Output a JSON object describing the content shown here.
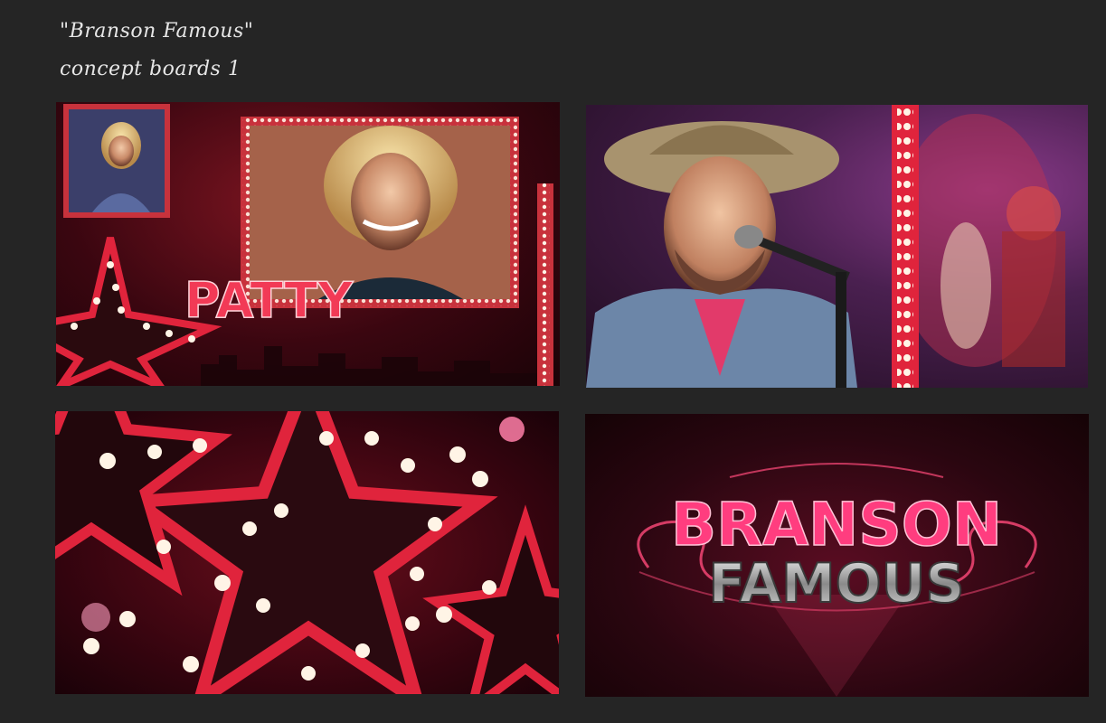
{
  "header": {
    "title": "\"Branson Famous\"",
    "subtitle": "concept boards 1"
  },
  "boards": {
    "board1": {
      "name_text": "PATTY"
    },
    "board4": {
      "logo_line1": "BRANSON",
      "logo_line2": "FAMOUS"
    }
  },
  "colors": {
    "background": "#252525",
    "accent_red": "#e0243c",
    "bulb": "#fff4e6",
    "pink": "#ff3d7f"
  }
}
